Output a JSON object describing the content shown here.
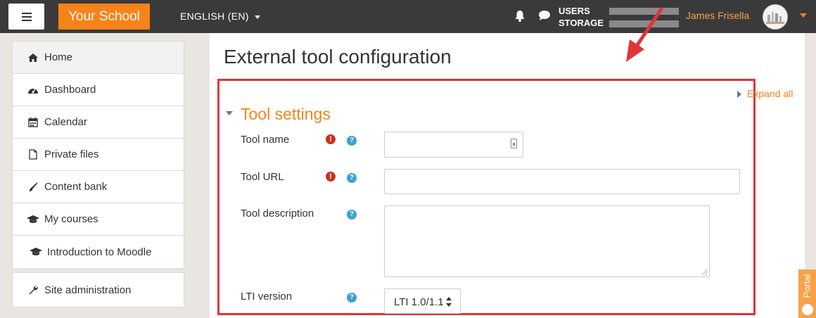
{
  "navbar": {
    "brand": "Your School",
    "language": "ENGLISH (EN)",
    "quota_users": "USERS",
    "quota_storage": "STORAGE",
    "user_name": "James Frisella"
  },
  "sidebar": {
    "items": [
      {
        "label": "Home",
        "icon": "home-icon"
      },
      {
        "label": "Dashboard",
        "icon": "dashboard-icon"
      },
      {
        "label": "Calendar",
        "icon": "calendar-icon"
      },
      {
        "label": "Private files",
        "icon": "file-icon"
      },
      {
        "label": "Content bank",
        "icon": "brush-icon"
      },
      {
        "label": "My courses",
        "icon": "graduation-cap-icon"
      },
      {
        "label": "Introduction to Moodle",
        "icon": "graduation-cap-icon"
      }
    ],
    "admin": {
      "label": "Site administration",
      "icon": "wrench-icon"
    }
  },
  "main": {
    "title": "External tool configuration",
    "expand_all": "Expand all",
    "section_title": "Tool settings",
    "fields": {
      "tool_name": {
        "label": "Tool name",
        "value": ""
      },
      "tool_url": {
        "label": "Tool URL",
        "value": ""
      },
      "tool_description": {
        "label": "Tool description",
        "value": ""
      },
      "lti_version": {
        "label": "LTI version",
        "selected": "LTI 1.0/1.1"
      }
    }
  },
  "portal": {
    "label": "Portal"
  },
  "colors": {
    "brand_orange": "#f7831a",
    "navbar_bg": "#3a3a3a",
    "highlight_red": "#e0343a",
    "required_red": "#ca3120",
    "help_blue": "#3ea0d3"
  }
}
